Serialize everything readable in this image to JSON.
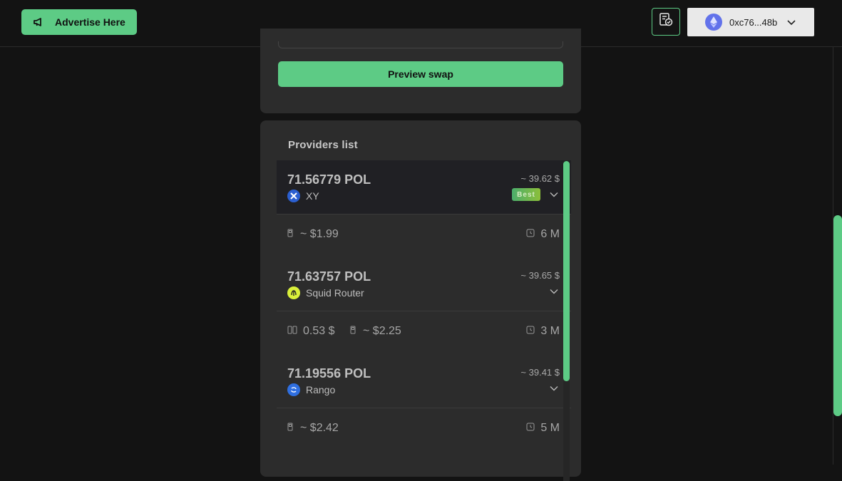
{
  "header": {
    "advertise_label": "Advertise Here",
    "wallet_address": "0xc76...48b"
  },
  "swap": {
    "preview_label": "Preview swap"
  },
  "providers": {
    "title": "Providers list",
    "items": [
      {
        "amount": "71.56779 POL",
        "name": "XY",
        "usd": "~ 39.62 $",
        "badge": "Best",
        "gas": "~ $1.99",
        "time": "6 M"
      },
      {
        "amount": "71.63757 POL",
        "name": "Squid Router",
        "usd": "~ 39.65 $",
        "fee": "0.53 $",
        "gas": "~ $2.25",
        "time": "3 M"
      },
      {
        "amount": "71.19556 POL",
        "name": "Rango",
        "usd": "~ 39.41 $",
        "gas": "~ $2.42",
        "time": "5 M"
      }
    ]
  },
  "colors": {
    "accent": "#5dcb85",
    "background": "#131313",
    "card": "#2c2c2c"
  },
  "icons": [
    "megaphone-icon",
    "transactions-icon",
    "ethereum-icon",
    "chevron-down-icon",
    "gas-pump-icon",
    "clock-icon",
    "fee-icon"
  ]
}
